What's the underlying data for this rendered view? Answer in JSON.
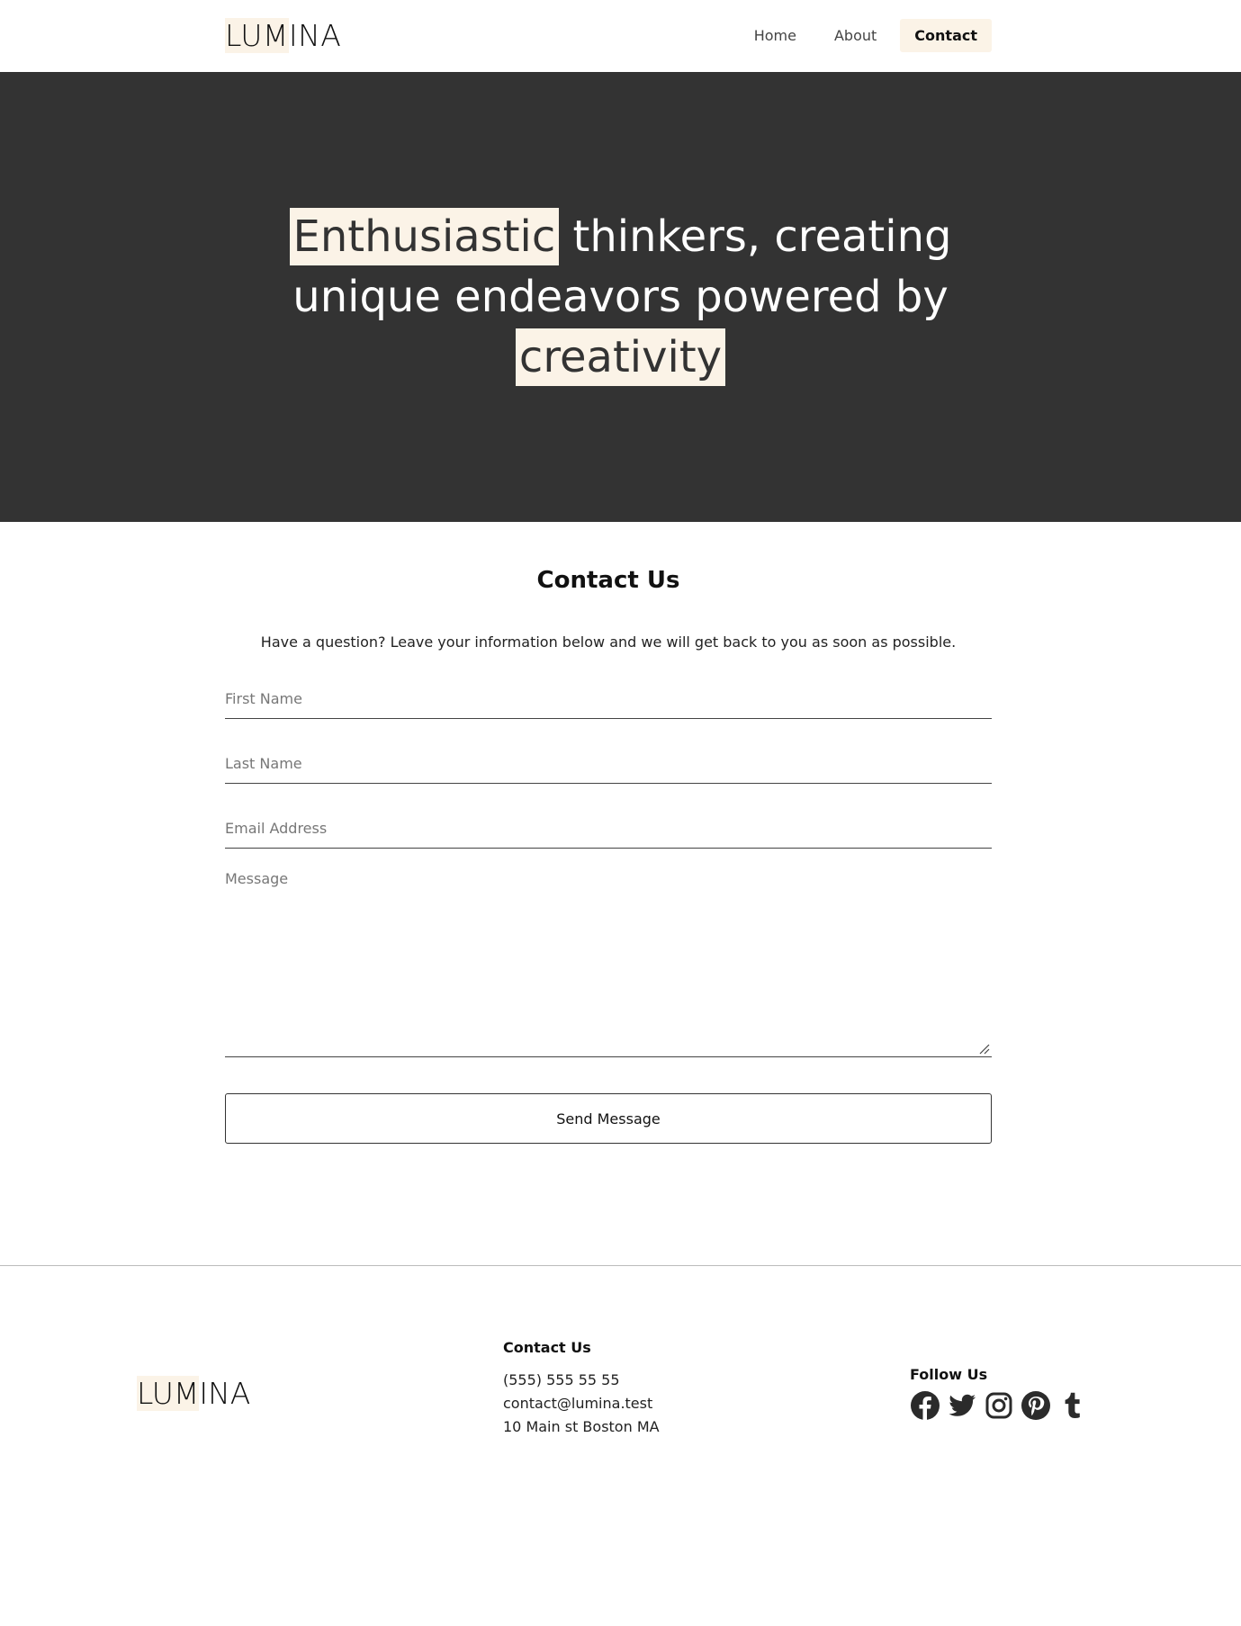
{
  "header": {
    "logo": {
      "part1": "LUM",
      "part2": "INA"
    },
    "nav": [
      {
        "label": "Home",
        "active": false
      },
      {
        "label": "About",
        "active": false
      },
      {
        "label": "Contact",
        "active": true
      }
    ]
  },
  "hero": {
    "word1": "Enthusiastic",
    "middle": "thinkers, creating unique endeavors powered by",
    "word2": "creativity"
  },
  "contact": {
    "title": "Contact Us",
    "intro": "Have a question? Leave your information below and we will get back to you as soon as possible.",
    "fields": {
      "first_name": "First Name",
      "last_name": "Last Name",
      "email": "Email Address",
      "message": "Message"
    },
    "send_label": "Send Message"
  },
  "footer": {
    "logo": {
      "part1": "LUM",
      "part2": "INA"
    },
    "contact_title": "Contact Us",
    "phone": "(555) 555 55 55",
    "email": "contact@lumina.test",
    "address": "10 Main st Boston MA",
    "follow_title": "Follow Us",
    "social_icons": [
      "facebook-icon",
      "twitter-icon",
      "instagram-icon",
      "pinterest-icon",
      "tumblr-icon"
    ]
  },
  "colors": {
    "accent": "#fbf3e7",
    "hero_bg": "#333333",
    "text": "#222222"
  }
}
